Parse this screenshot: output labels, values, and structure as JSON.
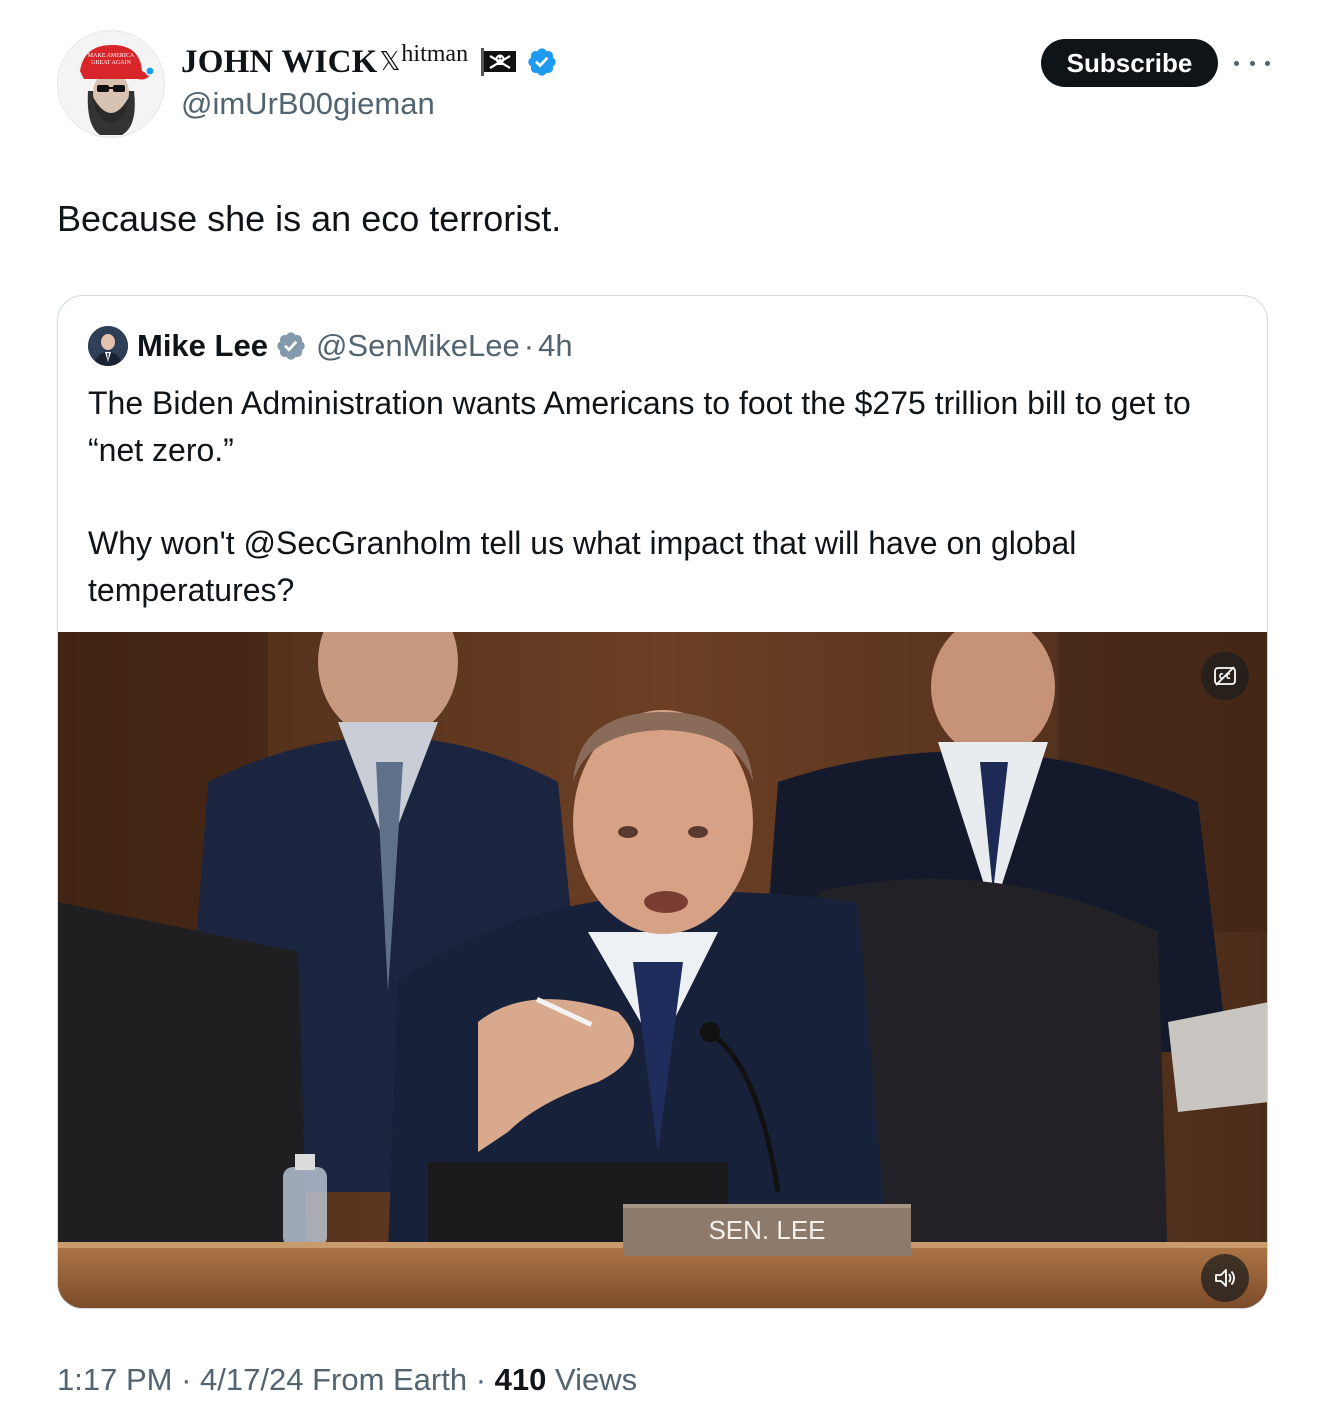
{
  "author": {
    "display_name": "JOHN WICK",
    "name_x": "𝕏",
    "name_suffix": "hitman",
    "flag_icon": "pirate-flag-icon",
    "verified_icon": "verified-badge-icon",
    "verified_color": "#1d9bf0",
    "handle": "@imUrB00gieman",
    "avatar_hat_text_line1": "MAKE AMERICA",
    "avatar_hat_text_line2": "GREAT AGAIN"
  },
  "actions": {
    "subscribe_label": "Subscribe",
    "more_icon": "more-horizontal-icon"
  },
  "tweet": {
    "text": "Because she is an eco terrorist."
  },
  "quoted": {
    "display_name": "Mike Lee",
    "verified_icon": "verified-badge-gray-icon",
    "handle": "@SenMikeLee",
    "separator": "·",
    "time": "4h",
    "paragraph1": "The Biden Administration wants Americans to foot the $275 trillion bill to get to “net zero.”",
    "paragraph2": "Why won't @SecGranholm tell us what impact that will have on global temperatures?",
    "video": {
      "nameplate_text": "SEN. LEE",
      "captions_icon": "captions-off-icon",
      "mute_icon": "speaker-icon"
    }
  },
  "footer": {
    "time": "1:17 PM",
    "sep": " · ",
    "date": "4/17/24",
    "source": " From Earth",
    "views_count": "410",
    "views_label": " Views"
  }
}
